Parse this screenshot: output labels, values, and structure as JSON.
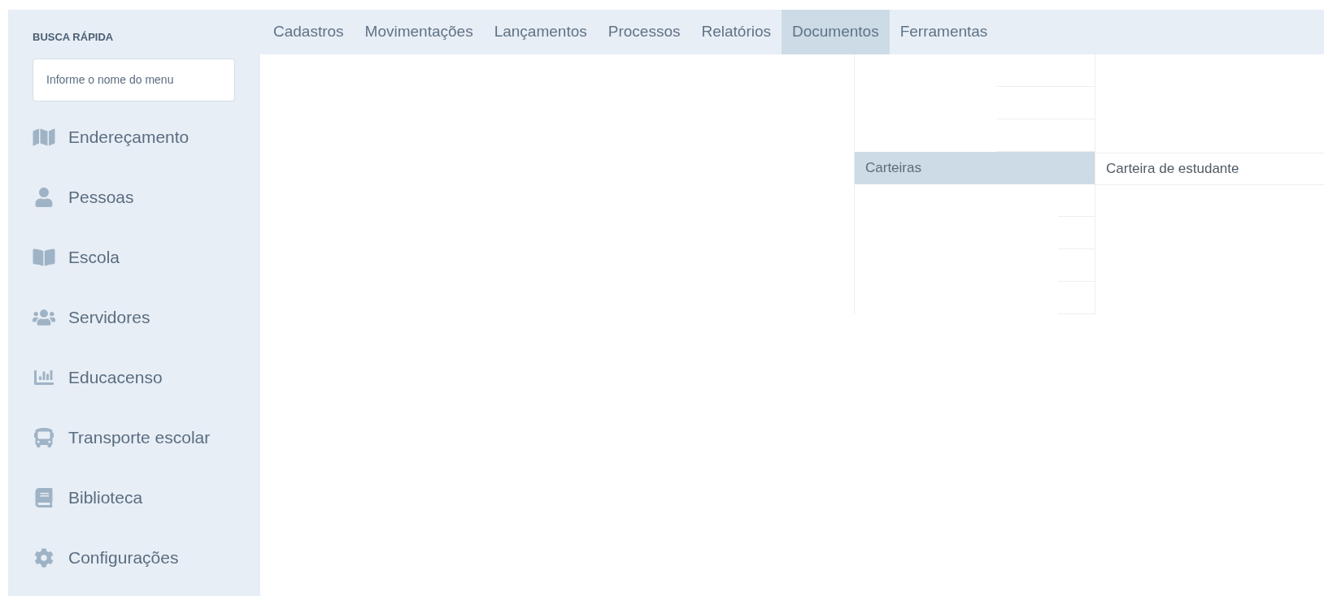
{
  "sidebar": {
    "title": "BUSCA RÁPIDA",
    "search": {
      "placeholder": "Informe o nome do menu"
    },
    "items": [
      {
        "label": "Endereçamento"
      },
      {
        "label": "Pessoas"
      },
      {
        "label": "Escola"
      },
      {
        "label": "Servidores"
      },
      {
        "label": "Educacenso"
      },
      {
        "label": "Transporte escolar"
      },
      {
        "label": "Biblioteca"
      },
      {
        "label": "Configurações"
      }
    ]
  },
  "menu_bar": {
    "items": [
      {
        "label": "Cadastros",
        "selected": false
      },
      {
        "label": "Movimentações",
        "selected": false
      },
      {
        "label": "Lançamentos",
        "selected": false
      },
      {
        "label": "Processos",
        "selected": false
      },
      {
        "label": "Relatórios",
        "selected": false
      },
      {
        "label": "Documentos",
        "selected": true
      },
      {
        "label": "Ferramentas",
        "selected": false
      }
    ]
  },
  "dropdown": {
    "items": [
      {
        "kind": "redacted"
      },
      {
        "kind": "redacted"
      },
      {
        "kind": "redacted"
      },
      {
        "kind": "item",
        "label": "Carteiras",
        "selected": true
      },
      {
        "kind": "blank"
      },
      {
        "kind": "blank"
      },
      {
        "kind": "blank"
      },
      {
        "kind": "blank"
      }
    ],
    "submenu": {
      "items": [
        {
          "label": "Carteira de estudante"
        }
      ]
    }
  }
}
